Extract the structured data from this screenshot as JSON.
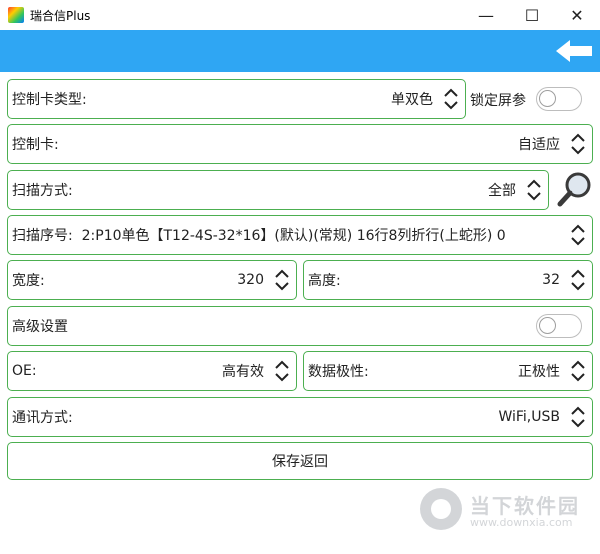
{
  "window": {
    "title": "瑞合信Plus",
    "minimize": "—",
    "maximize": "☐",
    "close": "✕"
  },
  "toolbar": {
    "color": "#2fa6f3",
    "back_icon": "arrow-left-icon"
  },
  "form": {
    "card_type": {
      "label": "控制卡类型:",
      "value": "单双色"
    },
    "lock_screen": {
      "label": "锁定屏参",
      "on": false
    },
    "card": {
      "label": "控制卡:",
      "value": "自适应"
    },
    "scan_mode": {
      "label": "扫描方式:",
      "value": "全部"
    },
    "scan_seq": {
      "label": "扫描序号:",
      "value": "2:P10单色【T12-4S-32*16】(默认)(常规) 16行8列折行(上蛇形) 0"
    },
    "width": {
      "label": "宽度:",
      "value": "320"
    },
    "height": {
      "label": "高度:",
      "value": "32"
    },
    "advanced": {
      "label": "高级设置",
      "on": false
    },
    "oe": {
      "label": "OE:",
      "value": "高有效"
    },
    "polarity": {
      "label": "数据极性:",
      "value": "正极性"
    },
    "comm": {
      "label": "通讯方式:",
      "value": "WiFi,USB"
    }
  },
  "save_button": {
    "label": "保存返回"
  },
  "watermark": {
    "text1": "当下软件园",
    "text2": "www.downxia.com"
  },
  "colors": {
    "border": "#4caf50",
    "accent": "#2fa6f3"
  }
}
